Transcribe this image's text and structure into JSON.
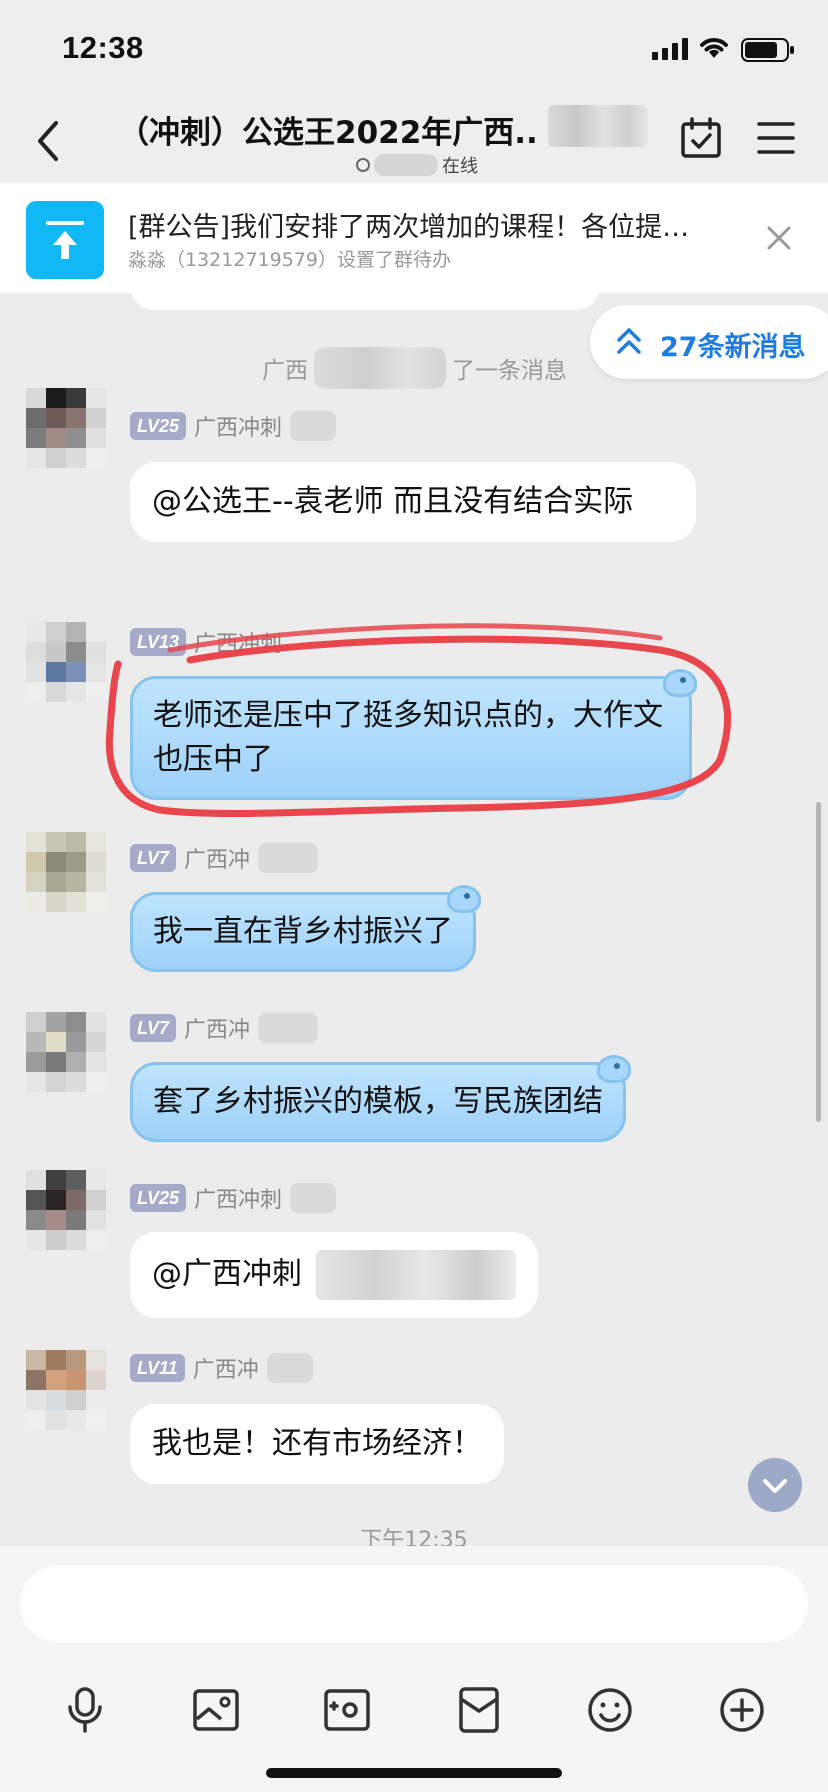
{
  "status_bar": {
    "time": "12:38"
  },
  "header": {
    "title": "（冲刺）公选王2022年广西..",
    "subtitle_status": "在线"
  },
  "announcement": {
    "title": "[群公告]我们安排了两次增加的课程！各位提…",
    "subtitle": "淼淼（13212719579）设置了群待办"
  },
  "new_messages": {
    "label": "27条新消息"
  },
  "system_notice": {
    "prefix": "广西",
    "suffix": "了一条消息"
  },
  "messages": [
    {
      "level": "LV25",
      "sender": "广西冲刺",
      "text": "@公选王--袁老师 而且没有结合实际",
      "style": "white"
    },
    {
      "level": "LV13",
      "sender": "广西冲刺",
      "text": "老师还是压中了挺多知识点的，大作文也压中了",
      "style": "blue"
    },
    {
      "level": "LV7",
      "sender": "广西冲",
      "text": "我一直在背乡村振兴了",
      "style": "blue"
    },
    {
      "level": "LV7",
      "sender": "广西冲",
      "text": "套了乡村振兴的模板，写民族团结",
      "style": "blue"
    },
    {
      "level": "LV25",
      "sender": "广西冲刺",
      "text": "@广西冲刺",
      "style": "white"
    },
    {
      "level": "LV11",
      "sender": "广西冲",
      "text": "我也是！还有市场经济！",
      "style": "white"
    }
  ],
  "timestamp": "下午12:35",
  "toolbar": {
    "icons": [
      "microphone-icon",
      "image-icon",
      "camera-icon",
      "red-packet-icon",
      "emoji-icon",
      "plus-icon"
    ]
  },
  "colors": {
    "accent_blue": "#1f7de0",
    "announce_icon": "#12b7f5",
    "bubble_blue": "#a9d6fb",
    "level_badge": "#a4aac8",
    "annotation_red": "#e8454d"
  }
}
